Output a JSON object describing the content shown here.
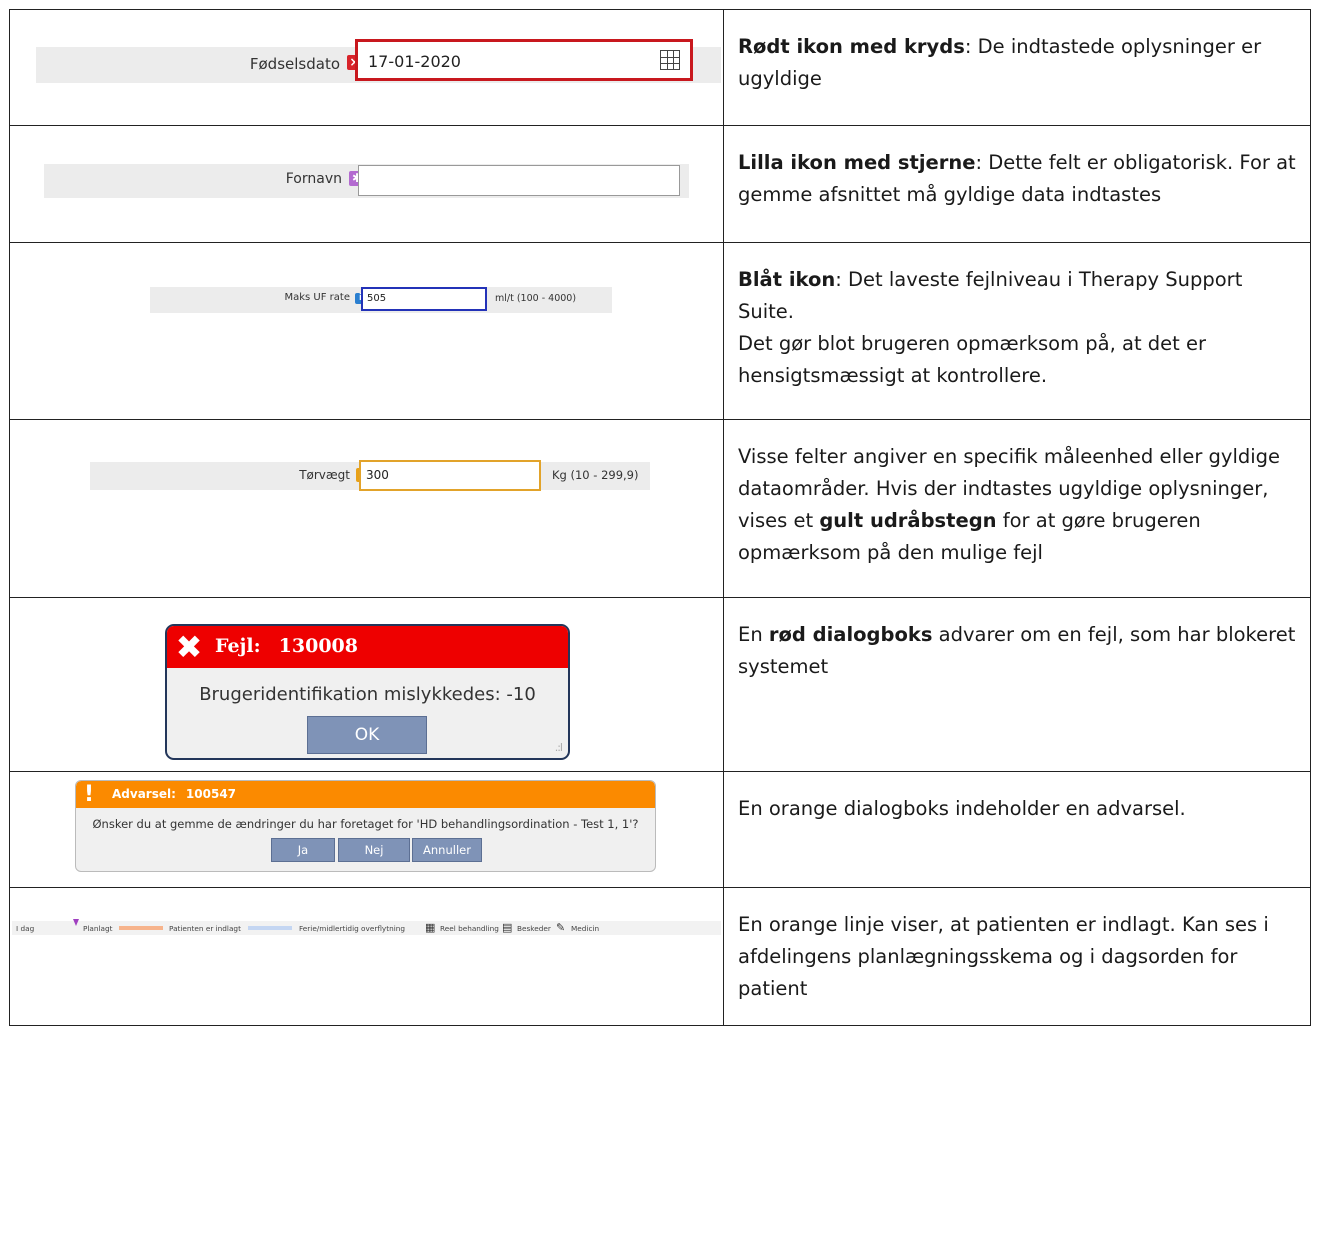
{
  "rows": {
    "r1": {
      "field_label": "Fødselsdato",
      "icon": "×",
      "input_value": "17-01-2020",
      "desc_bold": "Rødt ikon med kryds",
      "desc_rest": ": De indtastede oplysninger er ugyldige"
    },
    "r2": {
      "field_label": "Fornavn",
      "icon": "✱",
      "input_value": "",
      "desc_bold": "Lilla ikon med stjerne",
      "desc_rest": ": Dette felt er obligatorisk. For at gemme afsnittet må gyldige data indtastes"
    },
    "r3": {
      "field_label": "Maks UF rate",
      "icon": "i",
      "input_value": "505",
      "unit": "ml/t (100 - 4000)",
      "desc_bold": "Blåt ikon",
      "desc_rest": ": Det laveste fejlniveau i Therapy Support Suite.",
      "desc_line2": "Det gør blot brugeren opmærksom på, at det er hensigtsmæssigt at kontrollere."
    },
    "r4": {
      "field_label": "Tørvægt",
      "icon": "!",
      "input_value": "300",
      "unit": "Kg (10 - 299,9)",
      "desc_pre": "Visse felter angiver en specifik måleenhed eller gyldige dataområder. Hvis der indtastes ugyldige oplysninger, vises et ",
      "desc_bold": "gult udråbstegn",
      "desc_post": " for at gøre brugeren opmærksom på den mulige fejl"
    },
    "r5": {
      "dialog_icon": "✖",
      "dialog_title": "Fejl:",
      "dialog_code": "130008",
      "dialog_message": "Brugeridentifikation mislykkedes: -10",
      "ok_label": "OK",
      "desc_pre": "En ",
      "desc_bold": "rød dialogboks",
      "desc_post": " advarer om en fejl, som har blokeret systemet"
    },
    "r6": {
      "dialog_icon": "!",
      "dialog_title": "Advarsel:",
      "dialog_code": "100547",
      "dialog_message": "Ønsker du at gemme de ændringer du har foretaget for 'HD behandlingsordination - Test 1, 1'?",
      "btn_yes": "Ja",
      "btn_no": "Nej",
      "btn_cancel": "Annuller",
      "desc": "En orange dialogboks indeholder en advarsel."
    },
    "r7": {
      "legend": {
        "idag": "I dag",
        "planlagt": "Planlagt",
        "indlagt": "Patienten er indlagt",
        "ferie": "Ferie/midlertidig overflytning",
        "reel": "Reel behandling",
        "beskeder": "Beskeder",
        "medicin": "Medicin"
      },
      "colors": {
        "indlagt": "#f7b48c",
        "ferie": "#c4d6f2",
        "planlagt_mark": "#a040c0"
      },
      "desc": "En orange linje viser, at patienten er indlagt. Kan ses i afdelingens planlægningsskema og i dagsorden for patient"
    }
  }
}
